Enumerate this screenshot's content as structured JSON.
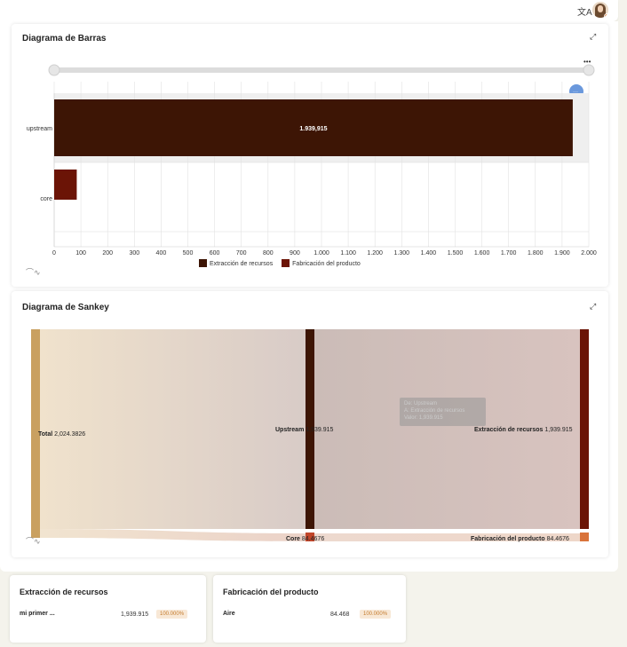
{
  "header": {
    "language_icon": "translate-icon",
    "avatar": "user-avatar"
  },
  "bar_card": {
    "title": "Diagrama de Barras",
    "expand_icon": "expand-icon",
    "menu_icon": "more-icon"
  },
  "sankey_card": {
    "title": "Diagrama de Sankey",
    "expand_icon": "expand-icon"
  },
  "chart_data": [
    {
      "type": "bar",
      "orientation": "horizontal",
      "categories": [
        "upstream",
        "core"
      ],
      "series": [
        {
          "name": "Extracción de recursos",
          "values": [
            1939.915,
            0
          ],
          "color": "#3d1505"
        },
        {
          "name": "Fabricación del producto",
          "values": [
            0,
            84.4676
          ],
          "color": "#6b1406"
        }
      ],
      "data_labels": [
        "1.939,915",
        ""
      ],
      "xlim": [
        0,
        2000
      ],
      "x_ticks": [
        "0",
        "100",
        "200",
        "300",
        "400",
        "500",
        "600",
        "700",
        "800",
        "900",
        "1.000",
        "1.100",
        "1.200",
        "1.300",
        "1.400",
        "1.500",
        "1.600",
        "1.700",
        "1.800",
        "1.900",
        "2.000"
      ],
      "legend_position": "bottom",
      "grid": true
    },
    {
      "type": "sankey",
      "nodes": [
        {
          "name": "Total",
          "value": "2,024.3826",
          "color": "#c9a060"
        },
        {
          "name": "Upstream",
          "value": "1,939.915",
          "color": "#3d1505"
        },
        {
          "name": "Core",
          "value": "84.4676",
          "color": "#c0452a"
        },
        {
          "name": "Extracción de recursos",
          "value": "1,939.915",
          "color": "#6b1406"
        },
        {
          "name": "Fabricación del producto",
          "value": "84.4676",
          "color": "#d9733a"
        }
      ],
      "links": [
        {
          "source": "Total",
          "target": "Upstream",
          "value": 1939.915
        },
        {
          "source": "Total",
          "target": "Core",
          "value": 84.4676
        },
        {
          "source": "Upstream",
          "target": "Extracción de recursos",
          "value": 1939.915
        },
        {
          "source": "Core",
          "target": "Fabricación del producto",
          "value": 84.4676
        }
      ],
      "tooltip": {
        "line1": "De: Upstream",
        "line2": "A: Extracción de recursos",
        "line3": "Valor: 1,939.915"
      }
    }
  ],
  "summary_cards": [
    {
      "title": "Extracción de recursos",
      "item": "mi primer ...",
      "value": "1,939.915",
      "percent": "100.000%"
    },
    {
      "title": "Fabricación del producto",
      "item": "Aire",
      "value": "84.468",
      "percent": "100.000%"
    }
  ]
}
